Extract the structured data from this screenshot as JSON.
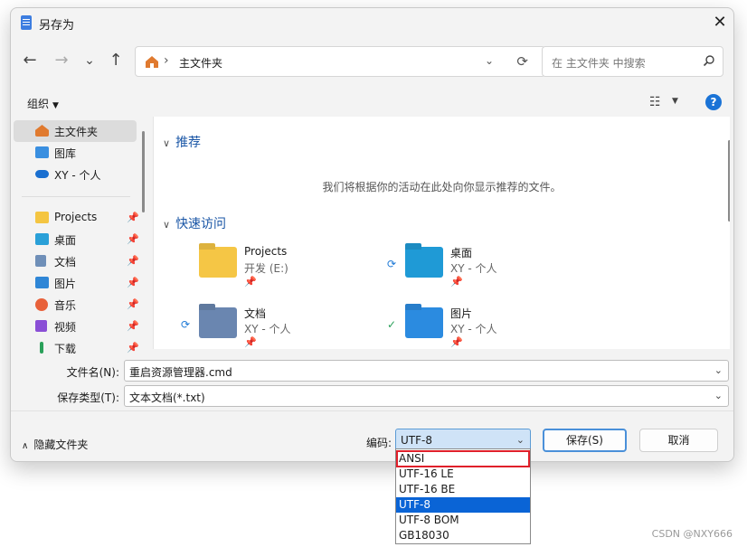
{
  "window": {
    "title": "另存为",
    "close_glyph": "✕"
  },
  "nav": {
    "back": "←",
    "forward": "→",
    "history": "⌄",
    "up": "↑"
  },
  "address": {
    "separator": "›",
    "path": "主文件夹",
    "dropdown_glyph": "⌄",
    "refresh_glyph": "⟳"
  },
  "search": {
    "placeholder": "在 主文件夹 中搜索"
  },
  "toolbar": {
    "organize_label": "组织",
    "organize_caret": "▼",
    "view_glyph": "☷",
    "view_caret": "▼",
    "help_glyph": "?"
  },
  "sidebar": {
    "items": [
      {
        "label": "主文件夹",
        "icon": "home-icon",
        "color": "#e07a2f"
      },
      {
        "label": "图库",
        "icon": "gallery-icon",
        "color": "#3a8fe0"
      },
      {
        "label": "XY - 个人",
        "icon": "onedrive-icon",
        "color": "#1a6fd0"
      },
      {
        "label": "Projects",
        "icon": "folder-icon",
        "color": "#f4c542",
        "pinned": true
      },
      {
        "label": "桌面",
        "icon": "desktop-icon",
        "color": "#2aa0d8",
        "pinned": true
      },
      {
        "label": "文档",
        "icon": "documents-icon",
        "color": "#6f8fb8",
        "pinned": true
      },
      {
        "label": "图片",
        "icon": "pictures-icon",
        "color": "#2f86d6",
        "pinned": true
      },
      {
        "label": "音乐",
        "icon": "music-icon",
        "color": "#e8613a",
        "pinned": true
      },
      {
        "label": "视频",
        "icon": "videos-icon",
        "color": "#8a4fd6",
        "pinned": true
      },
      {
        "label": "下载",
        "icon": "downloads-icon",
        "color": "#2aa05a",
        "pinned": true
      }
    ],
    "pin_glyph": "📌"
  },
  "content": {
    "recommended": {
      "title": "推荐",
      "chevron": "∨",
      "empty_message": "我们将根据你的活动在此处向你显示推荐的文件。"
    },
    "quick_access": {
      "title": "快速访问",
      "chevron": "∨",
      "items": [
        {
          "name": "Projects",
          "sub": "开发 (E:)",
          "icon": "projects-folder-icon",
          "color": "#f5c645",
          "status": ""
        },
        {
          "name": "桌面",
          "sub": "XY - 个人",
          "icon": "desktop-folder-icon",
          "color": "#1f9ad6",
          "status": "⟳"
        },
        {
          "name": "文档",
          "sub": "XY - 个人",
          "icon": "documents-folder-icon",
          "color": "#6a86b0",
          "status": "⟳"
        },
        {
          "name": "图片",
          "sub": "XY - 个人",
          "icon": "pictures-folder-icon",
          "color": "#2b8be0",
          "status": "✓"
        }
      ],
      "pin_glyph": "📌"
    }
  },
  "form": {
    "filename_label": "文件名(N):",
    "filename_value": "重启资源管理器.cmd",
    "filetype_label": "保存类型(T):",
    "filetype_value": "文本文档(*.txt)",
    "chevron": "⌄"
  },
  "footer": {
    "hide_folders_label": "隐藏文件夹",
    "hide_caret": "∧",
    "encoding_label": "编码:",
    "encoding_value": "UTF-8",
    "encoding_chevron": "⌄",
    "save_label": "保存(S)",
    "cancel_label": "取消"
  },
  "encoding_dropdown": {
    "options": [
      "ANSI",
      "UTF-16 LE",
      "UTF-16 BE",
      "UTF-8",
      "UTF-8 BOM",
      "GB18030"
    ],
    "selected": "UTF-8",
    "highlight_color": "#e0202a"
  },
  "watermark": "CSDN @NXY666"
}
